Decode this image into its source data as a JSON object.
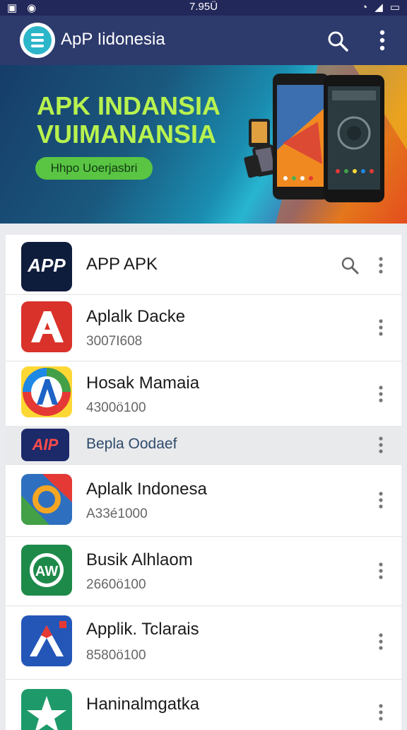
{
  "status_bar": {
    "time": "7.95Ü"
  },
  "app_bar": {
    "title": "ApP Iidonesia",
    "logo": "speaker-logo-icon",
    "search_icon": "search-icon",
    "more_icon": "more-vert-icon"
  },
  "banner": {
    "headline_1": "APK INDANSIA",
    "headline_2": "VUIMANANSIA",
    "button": "Hhpo Uoerjasbri"
  },
  "list": {
    "header": {
      "name": "APP APK",
      "icon_text": "APP"
    },
    "items": [
      {
        "name": "Aplalk Dacke",
        "sub": "3007I608"
      },
      {
        "name": "Hosak Mamaia",
        "sub": "4300ö100"
      },
      {
        "name": "Bepla Oodaef",
        "sub": "",
        "icon_text": "AIP"
      },
      {
        "name": "Aplalk Indonesa",
        "sub": "A33é1000"
      },
      {
        "name": "Busik Alhlaom",
        "sub": "2660ö100"
      },
      {
        "name": "Applik. Tclarais",
        "sub": "8580ö100"
      },
      {
        "name": "Haninalmgatka",
        "sub": ""
      }
    ]
  }
}
